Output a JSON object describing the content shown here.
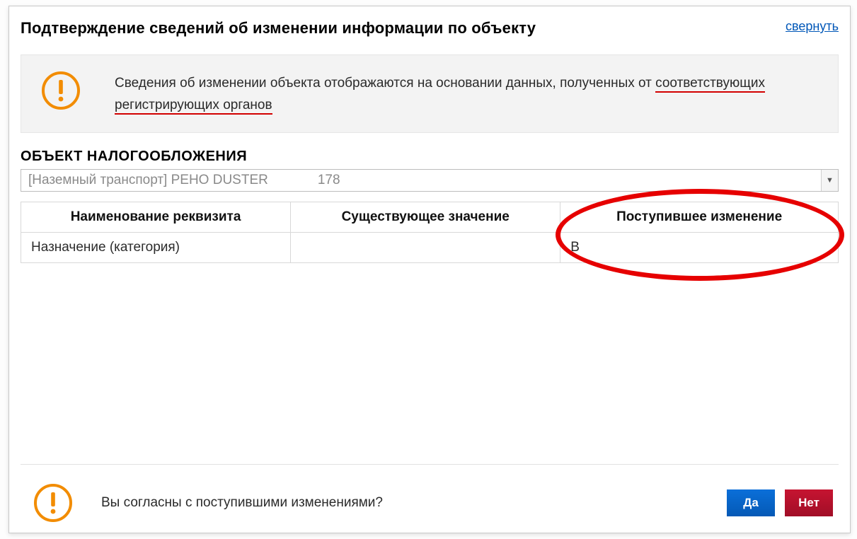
{
  "header": {
    "title": "Подтверждение сведений об изменении информации по объекту",
    "collapse": "свернуть"
  },
  "banner": {
    "text_prefix": "Сведения об изменении объекта отображаются на основании данных, полученных от ",
    "text_underlined_1": "соответствующих",
    "text_br": " ",
    "text_underlined_2": "регистрирующих органов"
  },
  "section": {
    "label": "ОБЪЕКТ НАЛОГООБЛОЖЕНИЯ"
  },
  "select": {
    "value_prefix": "[Наземный транспорт] РЕНО DUSTER",
    "value_suffix": "178"
  },
  "table": {
    "headers": {
      "name": "Наименование реквизита",
      "existing": "Существующее значение",
      "incoming": "Поступившее изменение"
    },
    "rows": [
      {
        "name": "Назначение (категория)",
        "existing": "",
        "incoming": "В"
      }
    ]
  },
  "footer": {
    "question": "Вы согласны с поступившими изменениями?",
    "yes": "Да",
    "no": "Нет"
  }
}
